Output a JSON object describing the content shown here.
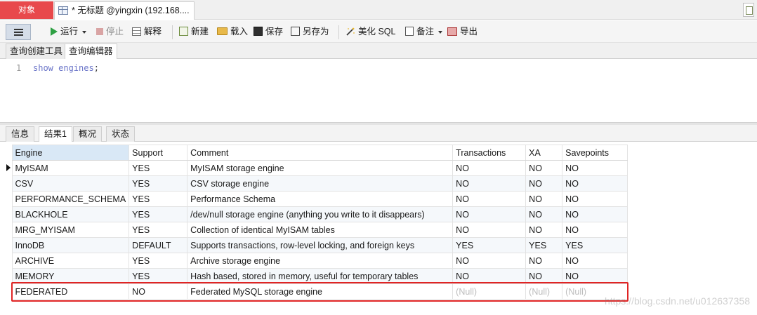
{
  "window_tabs": {
    "objects_label": "对象",
    "query_tab_title": "* 无标题 @yingxin (192.168...."
  },
  "toolbar": {
    "run_label": "运行",
    "stop_label": "停止",
    "explain_label": "解释",
    "new_label": "新建",
    "load_label": "载入",
    "save_label": "保存",
    "saveas_label": "另存为",
    "beautify_label": "美化 SQL",
    "note_label": "备注",
    "export_label": "导出"
  },
  "subtabs": {
    "builder": "查询创建工具",
    "editor": "查询编辑器"
  },
  "editor": {
    "line_number": "1",
    "code": "show engines",
    "terminator": ";"
  },
  "result_tabs": {
    "info": "信息",
    "result1": "结果1",
    "profile": "概况",
    "status": "状态"
  },
  "grid": {
    "columns": [
      "Engine",
      "Support",
      "Comment",
      "Transactions",
      "XA",
      "Savepoints"
    ],
    "rows": [
      [
        "MyISAM",
        "YES",
        "MyISAM storage engine",
        "NO",
        "NO",
        "NO"
      ],
      [
        "CSV",
        "YES",
        "CSV storage engine",
        "NO",
        "NO",
        "NO"
      ],
      [
        "PERFORMANCE_SCHEMA",
        "YES",
        "Performance Schema",
        "NO",
        "NO",
        "NO"
      ],
      [
        "BLACKHOLE",
        "YES",
        "/dev/null storage engine (anything you write to it disappears)",
        "NO",
        "NO",
        "NO"
      ],
      [
        "MRG_MYISAM",
        "YES",
        "Collection of identical MyISAM tables",
        "NO",
        "NO",
        "NO"
      ],
      [
        "InnoDB",
        "DEFAULT",
        "Supports transactions, row-level locking, and foreign keys",
        "YES",
        "YES",
        "YES"
      ],
      [
        "ARCHIVE",
        "YES",
        "Archive storage engine",
        "NO",
        "NO",
        "NO"
      ],
      [
        "MEMORY",
        "YES",
        "Hash based, stored in memory, useful for temporary tables",
        "NO",
        "NO",
        "NO"
      ],
      [
        "FEDERATED",
        "NO",
        "Federated MySQL storage engine",
        "(Null)",
        "(Null)",
        "(Null)"
      ]
    ]
  },
  "watermark": "https://blog.csdn.net/u012637358",
  "colors": {
    "objects_tab_bg": "#e8494c",
    "highlight_border": "#e02424",
    "keyword": "#6a74c8",
    "null_text": "#bdbdbd"
  }
}
